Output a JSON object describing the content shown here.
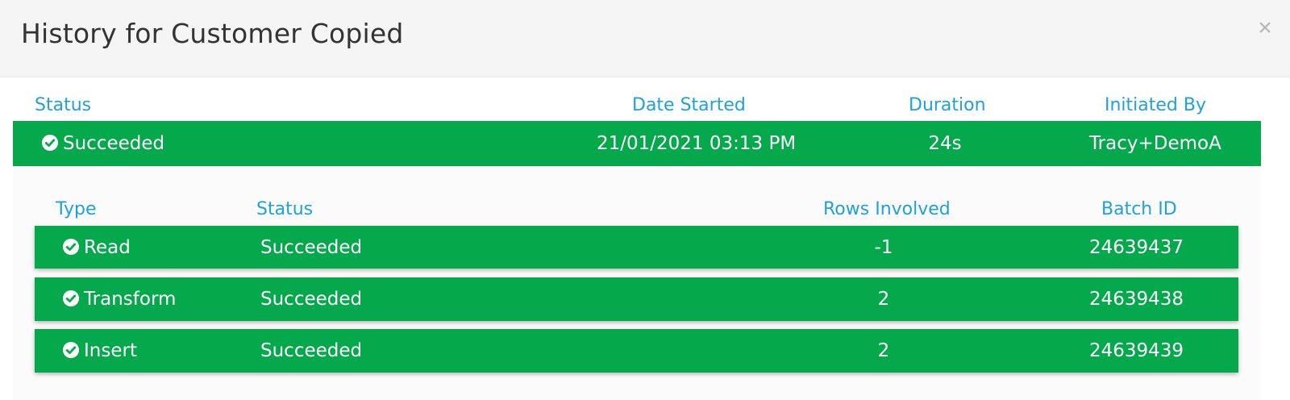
{
  "modal": {
    "title": "History for Customer Copied",
    "close_label": "×"
  },
  "summary": {
    "headers": {
      "status": "Status",
      "date_started": "Date Started",
      "duration": "Duration",
      "initiated_by": "Initiated By"
    },
    "row": {
      "status": "Succeeded",
      "date_started": "21/01/2021 03:13 PM",
      "duration": "24s",
      "initiated_by": "Tracy+DemoA",
      "icon": "check-circle-icon"
    }
  },
  "details": {
    "headers": {
      "type": "Type",
      "status": "Status",
      "rows_involved": "Rows Involved",
      "batch_id": "Batch ID"
    },
    "rows": [
      {
        "type": "Read",
        "status": "Succeeded",
        "rows_involved": "-1",
        "batch_id": "24639437",
        "icon": "check-circle-icon"
      },
      {
        "type": "Transform",
        "status": "Succeeded",
        "rows_involved": "2",
        "batch_id": "24639438",
        "icon": "check-circle-icon"
      },
      {
        "type": "Insert",
        "status": "Succeeded",
        "rows_involved": "2",
        "batch_id": "24639439",
        "icon": "check-circle-icon"
      }
    ]
  },
  "colors": {
    "success_green": "#05a84a",
    "header_blue": "#1ea1dc",
    "title_text": "#333333",
    "header_bg": "#f5f5f5"
  }
}
